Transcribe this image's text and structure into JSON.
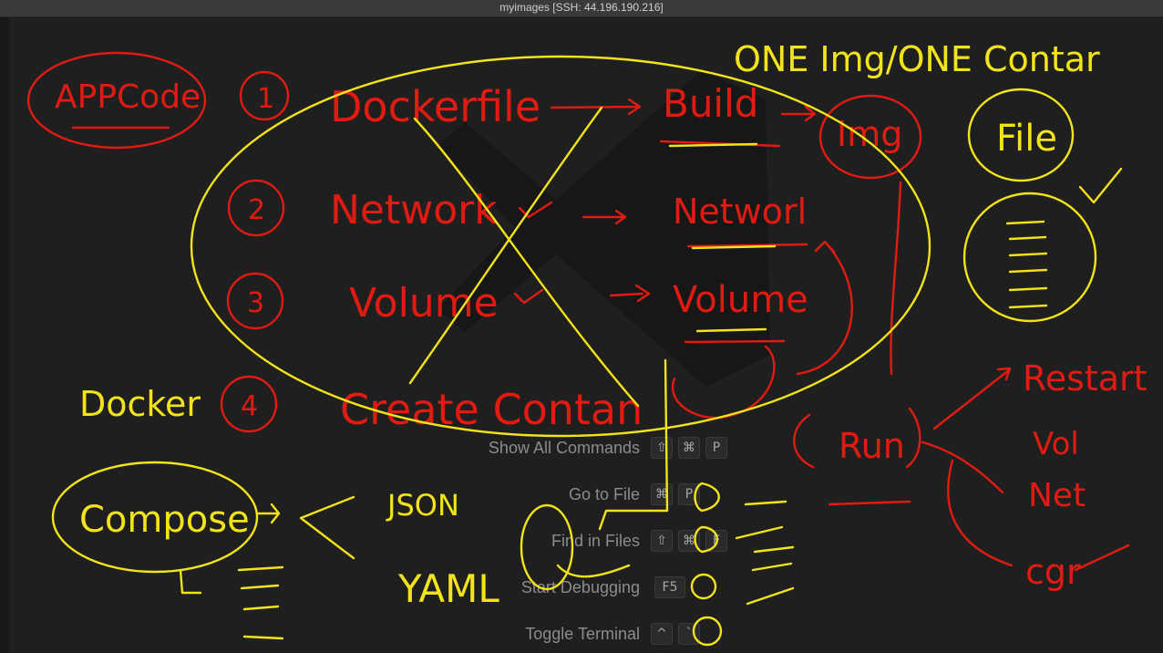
{
  "window": {
    "title": "myimages [SSH: 44.196.190.216]"
  },
  "commands": [
    {
      "label": "Show All Commands",
      "keys": [
        "⇧",
        "⌘",
        "P"
      ]
    },
    {
      "label": "Go to File",
      "keys": [
        "⌘",
        "P"
      ]
    },
    {
      "label": "Find in Files",
      "keys": [
        "⇧",
        "⌘",
        "F"
      ]
    },
    {
      "label": "Start Debugging",
      "keys": [
        "F5"
      ]
    },
    {
      "label": "Toggle Terminal",
      "keys": [
        "^",
        "`"
      ]
    }
  ],
  "annotations": {
    "app_code": "APPCode",
    "step1_num": "1",
    "step1": "Dockerfile",
    "step2_num": "2",
    "step2": "Network",
    "step3_num": "3",
    "step3": "Volume",
    "step4_num": "4",
    "step4": "Create Contan",
    "build": "Build",
    "network_out": "Networl",
    "volume_out": "Volume",
    "img": "Img",
    "one_img_one_container": "ONE Img/ONE Contar",
    "file": "File",
    "docker": "Docker",
    "compose": "Compose",
    "json": "JSON",
    "yaml": "YAML",
    "run": "Run",
    "restart": "Restart",
    "vol": "Vol",
    "net": "Net",
    "cgr": "cgr"
  },
  "colors": {
    "red_ink": "#e01b12",
    "yellow_ink": "#f2e31a",
    "editor_bg": "#1f1f1f"
  }
}
